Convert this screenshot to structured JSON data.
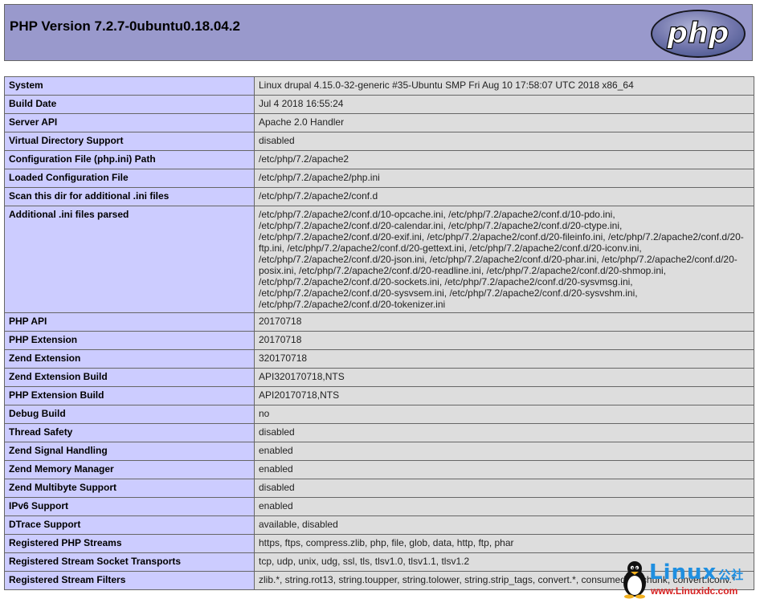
{
  "header": {
    "title": "PHP Version 7.2.7-0ubuntu0.18.04.2",
    "logo_text": "php"
  },
  "rows": [
    {
      "name": "System",
      "value": "Linux drupal 4.15.0-32-generic #35-Ubuntu SMP Fri Aug 10 17:58:07 UTC 2018 x86_64"
    },
    {
      "name": "Build Date",
      "value": "Jul 4 2018 16:55:24"
    },
    {
      "name": "Server API",
      "value": "Apache 2.0 Handler"
    },
    {
      "name": "Virtual Directory Support",
      "value": "disabled"
    },
    {
      "name": "Configuration File (php.ini) Path",
      "value": "/etc/php/7.2/apache2"
    },
    {
      "name": "Loaded Configuration File",
      "value": "/etc/php/7.2/apache2/php.ini"
    },
    {
      "name": "Scan this dir for additional .ini files",
      "value": "/etc/php/7.2/apache2/conf.d"
    },
    {
      "name": "Additional .ini files parsed",
      "value": "/etc/php/7.2/apache2/conf.d/10-opcache.ini, /etc/php/7.2/apache2/conf.d/10-pdo.ini, /etc/php/7.2/apache2/conf.d/20-calendar.ini, /etc/php/7.2/apache2/conf.d/20-ctype.ini, /etc/php/7.2/apache2/conf.d/20-exif.ini, /etc/php/7.2/apache2/conf.d/20-fileinfo.ini, /etc/php/7.2/apache2/conf.d/20-ftp.ini, /etc/php/7.2/apache2/conf.d/20-gettext.ini, /etc/php/7.2/apache2/conf.d/20-iconv.ini, /etc/php/7.2/apache2/conf.d/20-json.ini, /etc/php/7.2/apache2/conf.d/20-phar.ini, /etc/php/7.2/apache2/conf.d/20-posix.ini, /etc/php/7.2/apache2/conf.d/20-readline.ini, /etc/php/7.2/apache2/conf.d/20-shmop.ini, /etc/php/7.2/apache2/conf.d/20-sockets.ini, /etc/php/7.2/apache2/conf.d/20-sysvmsg.ini, /etc/php/7.2/apache2/conf.d/20-sysvsem.ini, /etc/php/7.2/apache2/conf.d/20-sysvshm.ini, /etc/php/7.2/apache2/conf.d/20-tokenizer.ini"
    },
    {
      "name": "PHP API",
      "value": "20170718"
    },
    {
      "name": "PHP Extension",
      "value": "20170718"
    },
    {
      "name": "Zend Extension",
      "value": "320170718"
    },
    {
      "name": "Zend Extension Build",
      "value": "API320170718,NTS"
    },
    {
      "name": "PHP Extension Build",
      "value": "API20170718,NTS"
    },
    {
      "name": "Debug Build",
      "value": "no"
    },
    {
      "name": "Thread Safety",
      "value": "disabled"
    },
    {
      "name": "Zend Signal Handling",
      "value": "enabled"
    },
    {
      "name": "Zend Memory Manager",
      "value": "enabled"
    },
    {
      "name": "Zend Multibyte Support",
      "value": "disabled"
    },
    {
      "name": "IPv6 Support",
      "value": "enabled"
    },
    {
      "name": "DTrace Support",
      "value": "available, disabled"
    },
    {
      "name": "Registered PHP Streams",
      "value": "https, ftps, compress.zlib, php, file, glob, data, http, ftp, phar"
    },
    {
      "name": "Registered Stream Socket Transports",
      "value": "tcp, udp, unix, udg, ssl, tls, tlsv1.0, tlsv1.1, tlsv1.2"
    },
    {
      "name": "Registered Stream Filters",
      "value": "zlib.*, string.rot13, string.toupper, string.tolower, string.strip_tags, convert.*, consumed, dechunk, convert.iconv.*"
    }
  ],
  "watermark": {
    "brand": "Linux",
    "brand_cn": "公社",
    "url": "www.Linuxidc.com"
  },
  "colors": {
    "header_bg": "#9999cc",
    "label_bg": "#ccccff",
    "value_bg": "#dddddd",
    "border": "#666666"
  }
}
